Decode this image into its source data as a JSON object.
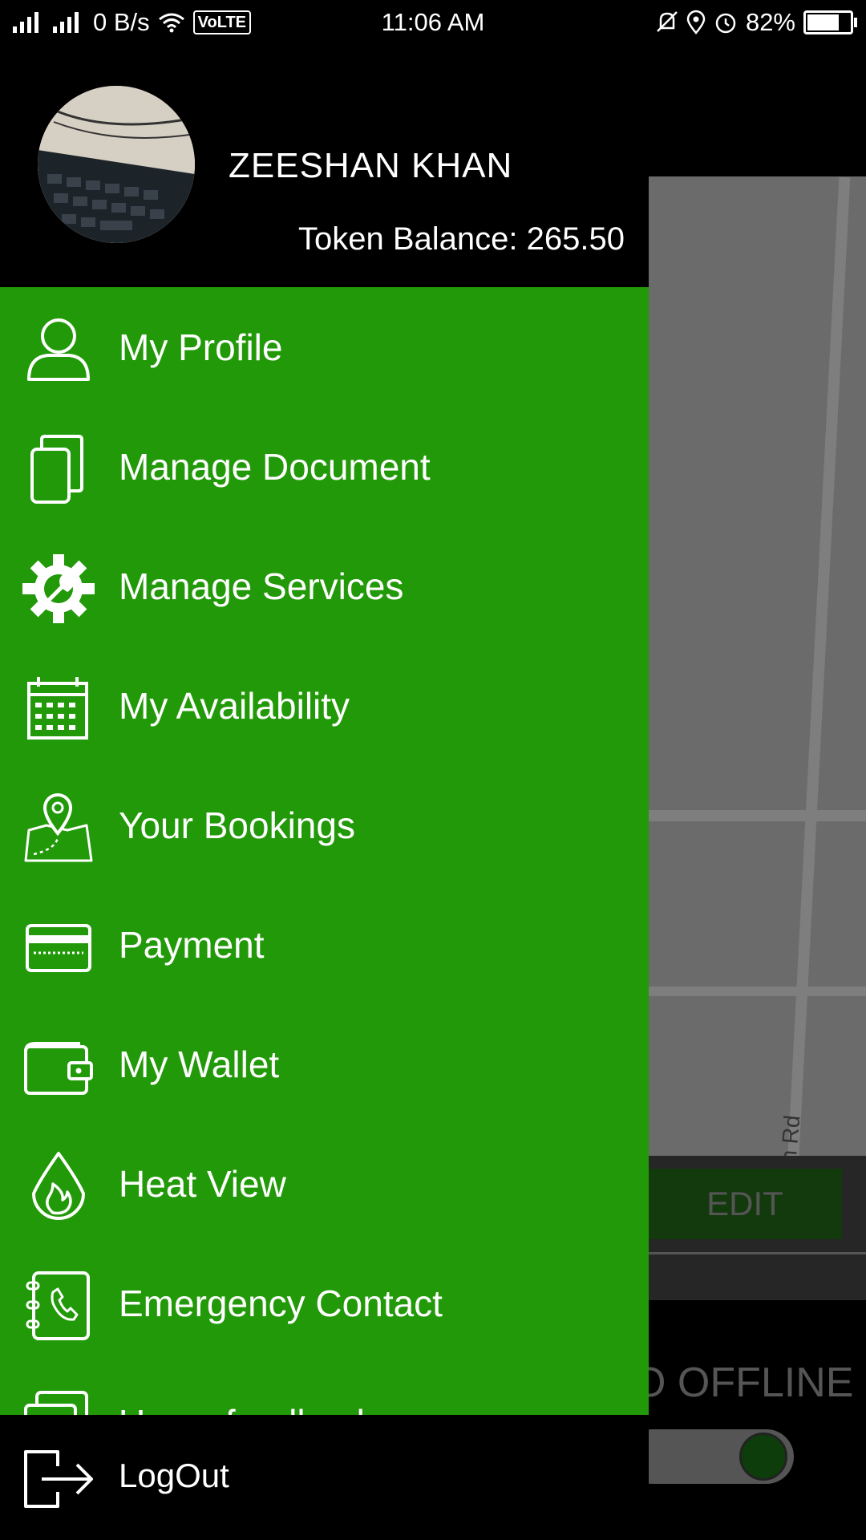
{
  "status_bar": {
    "network_speed": "0 B/s",
    "volte": "VoLTE",
    "time": "11:06 AM",
    "battery_percent": "82%",
    "battery_level": 0.82
  },
  "drawer": {
    "user_name": "ZEESHAN KHAN",
    "token_balance": "Token Balance: 265.50",
    "menu_items": [
      {
        "label": "My Profile",
        "icon": "person-icon"
      },
      {
        "label": "Manage Document",
        "icon": "documents-icon"
      },
      {
        "label": "Manage Services",
        "icon": "gear-wrench-icon"
      },
      {
        "label": "My Availability",
        "icon": "calendar-icon"
      },
      {
        "label": "Your Bookings",
        "icon": "map-pin-icon"
      },
      {
        "label": "Payment",
        "icon": "credit-card-icon"
      },
      {
        "label": "My Wallet",
        "icon": "wallet-icon"
      },
      {
        "label": "Heat View",
        "icon": "flame-icon"
      },
      {
        "label": "Emergency Contact",
        "icon": "phone-book-icon"
      },
      {
        "label": "Users feedback",
        "icon": "feedback-icon"
      }
    ],
    "logout_label": "LogOut"
  },
  "background": {
    "edit_label": "EDIT",
    "offline_label": "O OFFLINE",
    "road_label": "udaun Rd"
  },
  "colors": {
    "menu_green": "#229908",
    "header_black": "#000000"
  }
}
